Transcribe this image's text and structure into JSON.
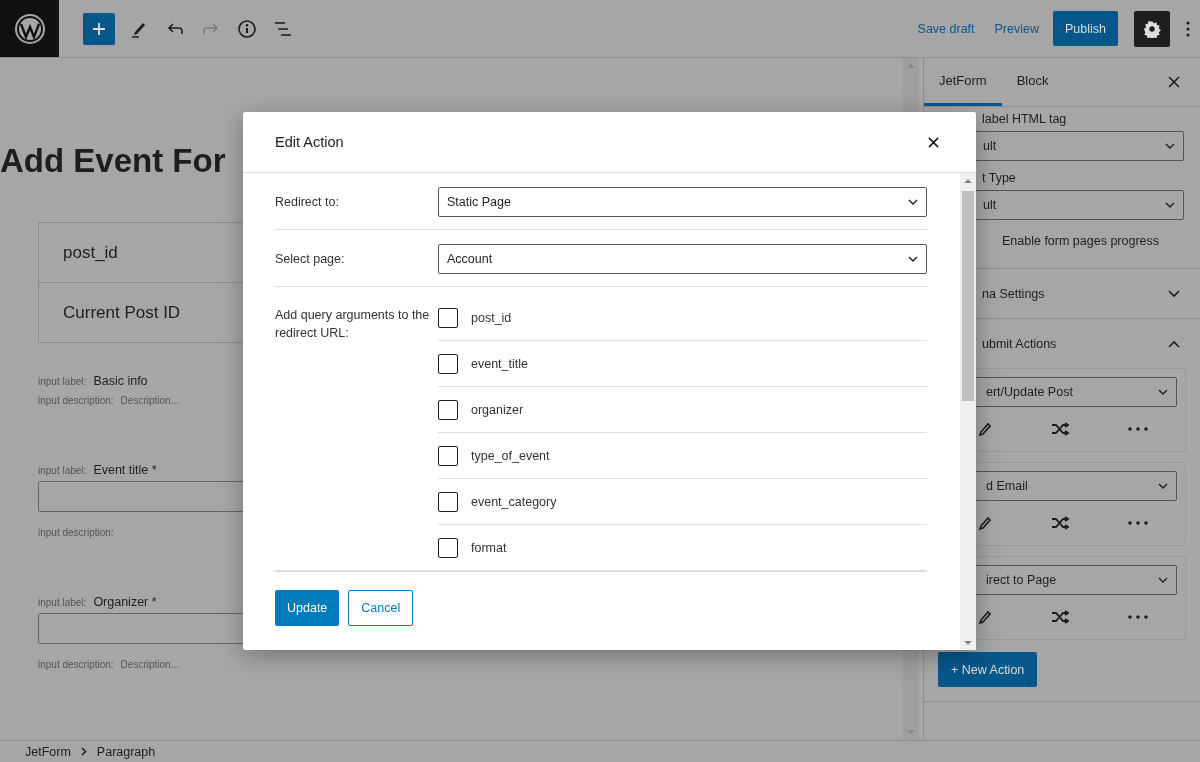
{
  "toolbar": {
    "tools": [
      {
        "kind": "add",
        "disabled": false
      },
      {
        "kind": "edit",
        "disabled": false
      },
      {
        "kind": "undo",
        "disabled": false
      },
      {
        "kind": "redo",
        "disabled": true
      },
      {
        "kind": "info",
        "disabled": false
      },
      {
        "kind": "outline",
        "disabled": false
      }
    ],
    "save_draft": "Save draft",
    "preview": "Preview",
    "publish": "Publish"
  },
  "editor": {
    "title": "Add Event For",
    "fields": [
      {
        "kind": "hidden",
        "label": "post_id",
        "value": "Current Post ID"
      },
      {
        "kind": "heading",
        "label_prefix": "input label:",
        "label": "Basic info",
        "description_prefix": "input description:",
        "description": "Description..."
      },
      {
        "kind": "text",
        "label_prefix": "input label:",
        "label": "Event title *",
        "description_prefix": "input description:"
      },
      {
        "kind": "text",
        "label_prefix": "input label:",
        "label": "Organizer *",
        "description_prefix": "input description:",
        "description": "Description..."
      }
    ]
  },
  "breadcrumbs": [
    "JetForm",
    "Paragraph"
  ],
  "sidebar": {
    "tabs": [
      {
        "label": "JetForm",
        "selected": true
      },
      {
        "label": "Block",
        "selected": false
      }
    ],
    "settings": [
      {
        "kind": "select",
        "label": "label HTML tag",
        "value": "ult"
      },
      {
        "kind": "select",
        "label": "t Type",
        "value": "ult"
      },
      {
        "kind": "toggle",
        "label": "Enable form pages progress"
      }
    ],
    "sections": [
      {
        "title": "na Settings",
        "expanded": false
      },
      {
        "title": "ubmit Actions",
        "expanded": true
      }
    ],
    "actions": [
      {
        "type": "ert/Update Post"
      },
      {
        "type": "d Email"
      },
      {
        "type": "irect to Page"
      }
    ],
    "new_action": "+ New Action"
  },
  "modal": {
    "title": "Edit Action",
    "redirect_label": "Redirect to:",
    "redirect_value": "Static Page",
    "page_label": "Select page:",
    "page_value": "Account",
    "args_label": "Add query arguments to the redirect URL:",
    "args": [
      {
        "label": "post_id",
        "checked": false
      },
      {
        "label": "event_title",
        "checked": false
      },
      {
        "label": "organizer",
        "checked": false
      },
      {
        "label": "type_of_event",
        "checked": false
      },
      {
        "label": "event_category",
        "checked": false
      },
      {
        "label": "format",
        "checked": false
      }
    ],
    "update": "Update",
    "cancel": "Cancel"
  }
}
